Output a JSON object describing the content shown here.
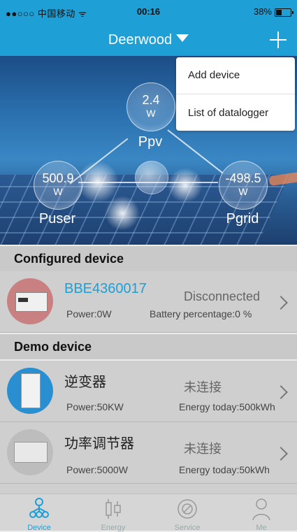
{
  "status_bar": {
    "carrier": "●●○○○ 中国移动 ᯤ",
    "time": "00:16",
    "battery": "38%"
  },
  "header": {
    "title": "Deerwood"
  },
  "dropdown": {
    "items": [
      "Add device",
      "List of datalogger"
    ]
  },
  "hero": {
    "ppv": {
      "value": "2.4",
      "unit": "W",
      "label": "Ppv"
    },
    "puser": {
      "value": "500.9",
      "unit": "W",
      "label": "Puser"
    },
    "pgrid": {
      "value": "-498.5",
      "unit": "W",
      "label": "Pgrid"
    }
  },
  "configured": {
    "title": "Configured device",
    "devices": [
      {
        "name": "BBE4360017",
        "status": "Disconnected",
        "power": "Power:0W",
        "extra": "Battery percentage:0 %",
        "name_color": "#1e9fd6"
      }
    ]
  },
  "demo": {
    "title": "Demo device",
    "devices": [
      {
        "name": "逆变器",
        "status": "未连接",
        "power": "Power:50KW",
        "extra": "Energy today:500kWh"
      },
      {
        "name": "功率调节器",
        "status": "未连接",
        "power": "Power:5000W",
        "extra": "Energy today:50kWh"
      }
    ]
  },
  "tabs": [
    {
      "label": "Device",
      "icon": "device-icon",
      "active": true
    },
    {
      "label": "Energy",
      "icon": "energy-icon",
      "active": false
    },
    {
      "label": "Service",
      "icon": "service-icon",
      "active": false
    },
    {
      "label": "Me",
      "icon": "me-icon",
      "active": false
    }
  ],
  "colors": {
    "accent": "#1e9fd6"
  }
}
